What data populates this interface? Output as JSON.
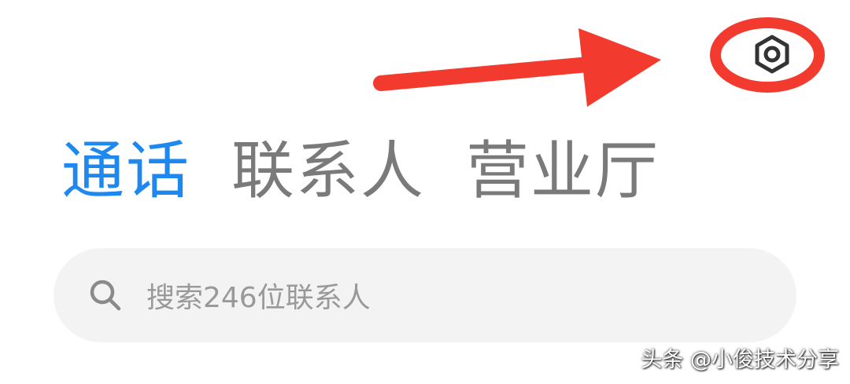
{
  "header": {
    "settings_icon": "settings-hex-nut-icon"
  },
  "annotation": {
    "color": "#f23a2e",
    "shapes": [
      "arrow",
      "ellipse"
    ]
  },
  "tabs": [
    {
      "label": "通话",
      "active": true
    },
    {
      "label": "联系人",
      "active": false
    },
    {
      "label": "营业厅",
      "active": false
    }
  ],
  "search": {
    "icon": "search-icon",
    "placeholder": "搜索246位联系人"
  },
  "watermark": "头条 @小俊技术分享",
  "colors": {
    "accent": "#1e88ee",
    "tab_inactive": "#7a7a7a",
    "search_bg": "#f3f3f3",
    "placeholder": "#999999",
    "icon": "#333333"
  }
}
